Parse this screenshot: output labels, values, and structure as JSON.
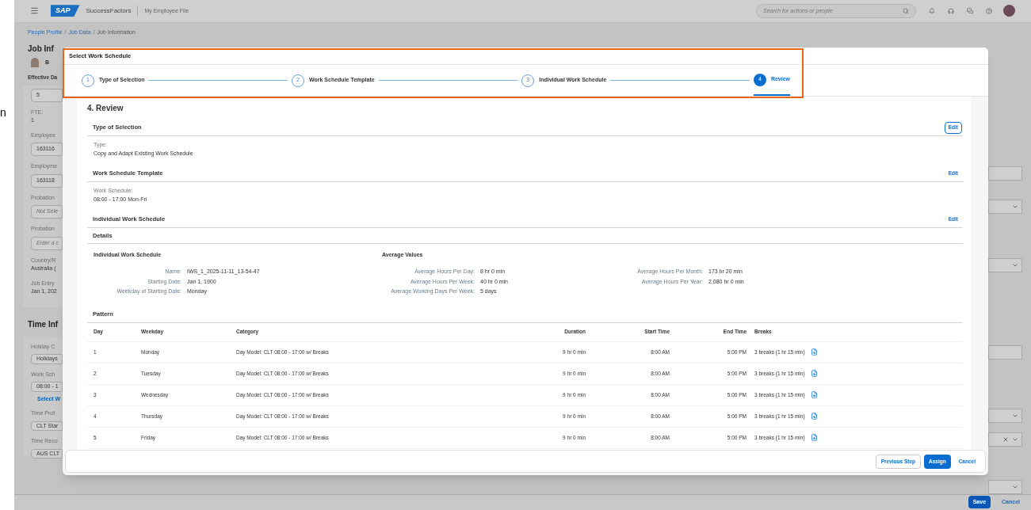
{
  "edge_fragment": "n",
  "topbar": {
    "logo": "SAP",
    "product": "SuccessFactors",
    "page": "My Employee File",
    "search": {
      "placeholder": "Search for actions or people"
    }
  },
  "breadcrumb": [
    {
      "kind": "link",
      "text": "People Profile"
    },
    {
      "kind": "separator",
      "text": "/"
    },
    {
      "kind": "link",
      "text": "Job Data"
    },
    {
      "kind": "separator",
      "text": "/"
    },
    {
      "kind": "current",
      "text": "Job Information"
    }
  ],
  "background_page": {
    "job_section": {
      "title": "Job Inf",
      "person": "B",
      "subheading": "Effective Da",
      "fields": [
        {
          "kind": "input",
          "value": "5"
        },
        {
          "kind": "label",
          "text": "FTE:"
        },
        {
          "kind": "value",
          "text": "1"
        },
        {
          "kind": "label",
          "text": "Employee"
        },
        {
          "kind": "input",
          "value": "163116"
        },
        {
          "kind": "label",
          "text": "Employme"
        },
        {
          "kind": "input",
          "value": "163118"
        },
        {
          "kind": "label",
          "text": "Probation"
        },
        {
          "kind": "input",
          "placeholder": "Not Sele"
        },
        {
          "kind": "label",
          "text": "Probation"
        },
        {
          "kind": "input",
          "placeholder": "Enter a c"
        },
        {
          "kind": "label",
          "text": "Country/R"
        },
        {
          "kind": "value",
          "text": "Australia ("
        },
        {
          "kind": "label",
          "text": "Job Entry"
        },
        {
          "kind": "value",
          "text": "Jan 1, 202"
        }
      ]
    },
    "time_section": {
      "title": "Time Inf",
      "fields": [
        {
          "kind": "label",
          "text": "Holiday C"
        },
        {
          "kind": "input",
          "value": "Holidays"
        },
        {
          "kind": "label",
          "text": "Work Sch"
        },
        {
          "kind": "input",
          "value": "08:00 - 1"
        },
        {
          "kind": "link",
          "text": "Select W"
        },
        {
          "kind": "label",
          "text": "Time Prof"
        },
        {
          "kind": "input",
          "value": "CLT Star"
        },
        {
          "kind": "label",
          "text": "Time Reco"
        },
        {
          "kind": "input",
          "value": "AUS CLT"
        }
      ]
    },
    "right_fields": [
      {
        "kind": "input",
        "clearable": false
      },
      {
        "kind": "select",
        "clearable": false
      },
      {
        "kind": "select",
        "clearable": false
      },
      {
        "kind": "input",
        "clearable": false
      },
      {
        "kind": "select",
        "clearable": false
      },
      {
        "kind": "select",
        "clearable": true
      },
      {
        "kind": "select",
        "clearable": false
      }
    ],
    "footer_buttons": [
      {
        "label": "Save",
        "primary": true
      },
      {
        "label": "Cancel",
        "primary": false
      }
    ]
  },
  "dialog": {
    "title": "Select Work Schedule",
    "steps": [
      {
        "number": "1",
        "label": "Type of Selection",
        "selected": false
      },
      {
        "number": "2",
        "label": "Work Schedule Template",
        "selected": false
      },
      {
        "number": "3",
        "label": "Individual Work Schedule",
        "selected": false
      },
      {
        "number": "4",
        "label": "Review",
        "selected": true
      }
    ],
    "heading": "4. Review",
    "sections": [
      {
        "title": "Type of Selection",
        "edit": "Edit",
        "edit_focused": true,
        "fields": [
          {
            "label": "Type:",
            "value": "Copy and Adapt Existing Work Schedule"
          }
        ]
      },
      {
        "title": "Work Schedule Template",
        "edit": "Edit",
        "edit_focused": false,
        "fields": [
          {
            "label": "Work Schedule:",
            "value": "08:00 - 17:00 Mon-Fri"
          }
        ]
      },
      {
        "title": "Individual Work Schedule",
        "edit": "Edit",
        "edit_focused": false
      }
    ],
    "details": {
      "title": "Details",
      "groups": [
        {
          "heading": "Individual Work Schedule",
          "rows": [
            {
              "label": "Name:",
              "value": "IWS_1_2025-11-11_13-54-47"
            },
            {
              "label": "Starting Date:",
              "value": "Jan 1, 1900"
            },
            {
              "label": "Weekday of Starting Date:",
              "value": "Monday"
            }
          ]
        },
        {
          "heading": "Average Values",
          "rows": [
            {
              "label": "Average Hours Per Day:",
              "value": "8 hr 0 min"
            },
            {
              "label": "Average Hours Per Week:",
              "value": "40 hr 0 min"
            },
            {
              "label": "Average Working Days Per Week:",
              "value": "5 days"
            }
          ]
        },
        {
          "rows": [
            {
              "label": "Average Hours Per Month:",
              "value": "173 hr 20 min"
            },
            {
              "label": "Average Hours Per Year:",
              "value": "2,080 hr 0 min"
            }
          ]
        }
      ]
    },
    "pattern": {
      "title": "Pattern",
      "columns": [
        "Day",
        "Weekday",
        "Category",
        "Duration",
        "Start Time",
        "End Time",
        "Breaks"
      ],
      "rows": [
        [
          "1",
          "Monday",
          "Day Model: CLT 08:00 - 17:00 w/ Breaks",
          "9 hr 0 min",
          "8:00 AM",
          "5:00 PM",
          "3 breaks (1 hr 15 min)"
        ],
        [
          "2",
          "Tuesday",
          "Day Model: CLT 08:00 - 17:00 w/ Breaks",
          "9 hr 0 min",
          "8:00 AM",
          "5:00 PM",
          "3 breaks (1 hr 15 min)"
        ],
        [
          "3",
          "Wednesday",
          "Day Model: CLT 08:00 - 17:00 w/ Breaks",
          "9 hr 0 min",
          "8:00 AM",
          "5:00 PM",
          "3 breaks (1 hr 15 min)"
        ],
        [
          "4",
          "Thursday",
          "Day Model: CLT 08:00 - 17:00 w/ Breaks",
          "9 hr 0 min",
          "8:00 AM",
          "5:00 PM",
          "3 breaks (1 hr 15 min)"
        ],
        [
          "5",
          "Friday",
          "Day Model: CLT 08:00 - 17:00 w/ Breaks",
          "9 hr 0 min",
          "8:00 AM",
          "5:00 PM",
          "3 breaks (1 hr 15 min)"
        ]
      ]
    },
    "buttons": [
      {
        "label": "Previous Step",
        "kind": "secondary"
      },
      {
        "label": "Assign",
        "kind": "primary"
      },
      {
        "label": "Cancel",
        "kind": "link"
      }
    ]
  }
}
